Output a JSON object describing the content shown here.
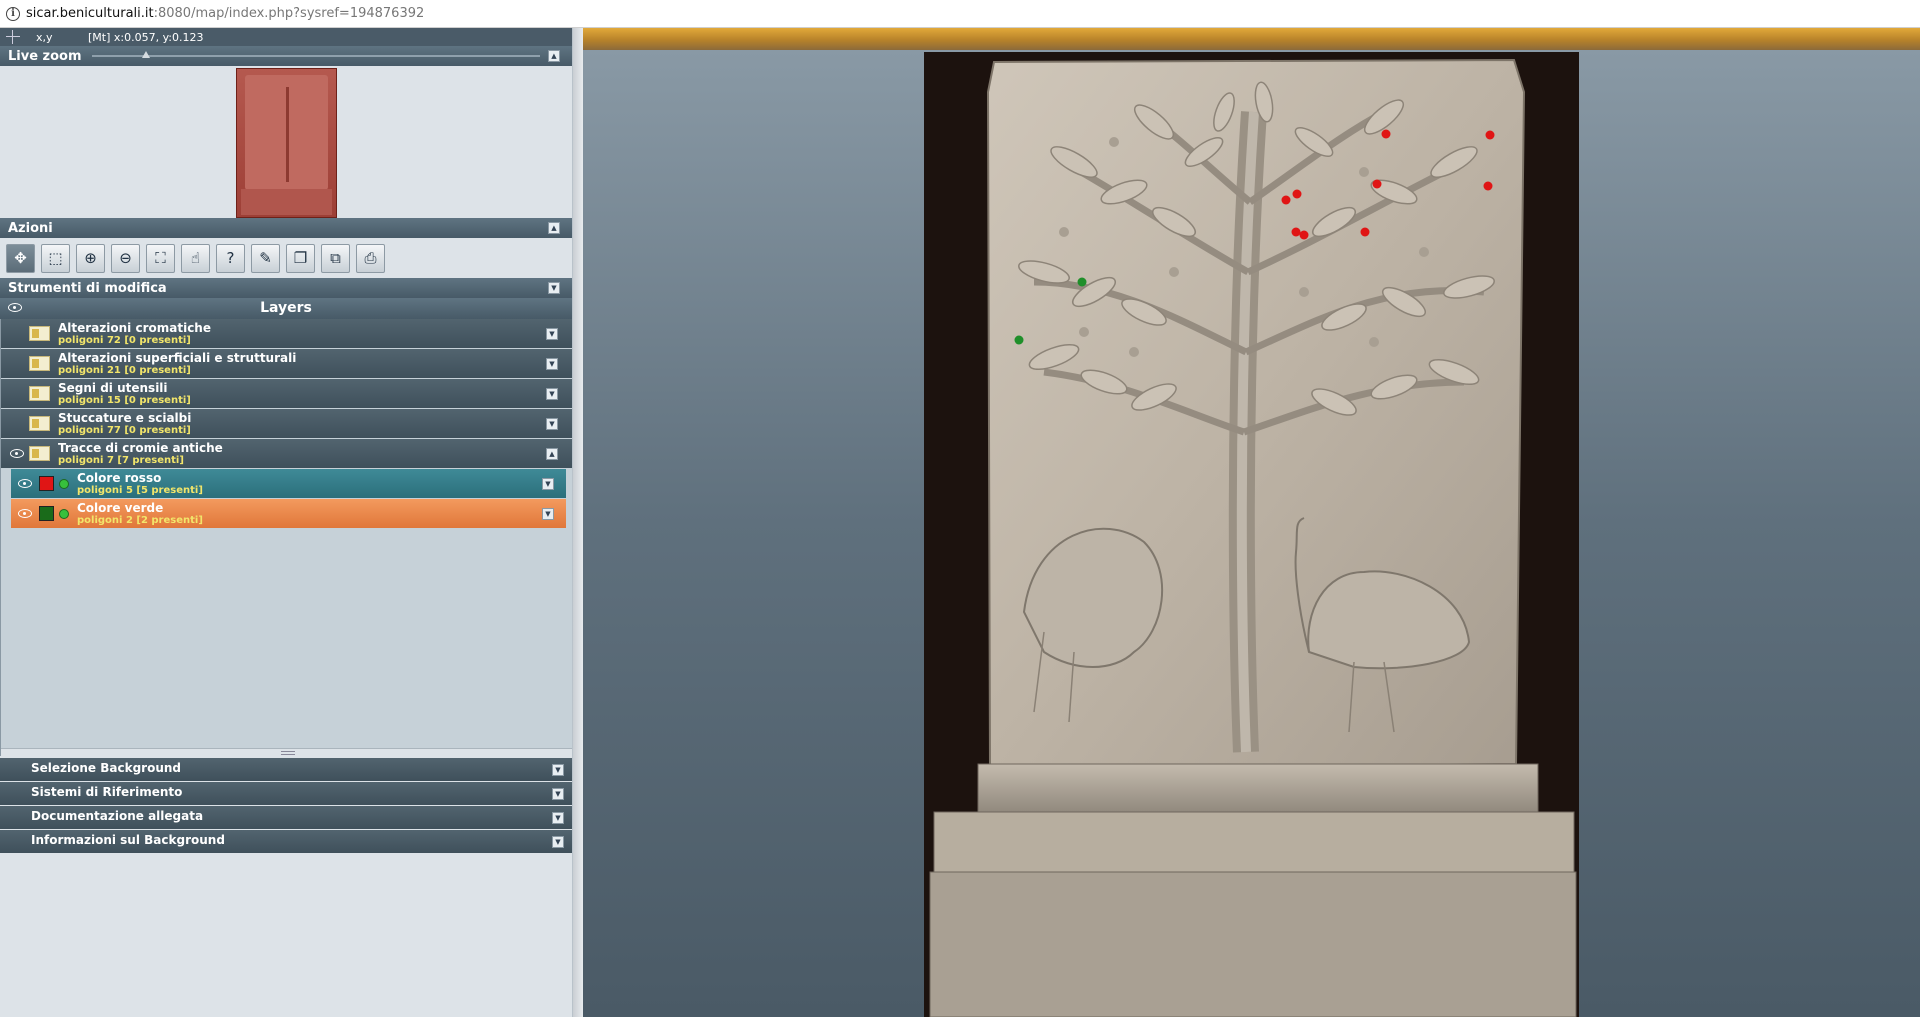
{
  "browser": {
    "url_host": "sicar.beniculturali.it",
    "url_rest": ":8080/map/index.php?sysref=194876392"
  },
  "coords": {
    "label": "x,y",
    "value": "[Mt] x:0.057, y:0.123"
  },
  "livezoom": {
    "title": "Live zoom",
    "zoom_level": 0.12
  },
  "actions": {
    "title": "Azioni",
    "tools": [
      {
        "name": "pan-icon",
        "glyph": "✥"
      },
      {
        "name": "box-select-icon",
        "glyph": "⬚"
      },
      {
        "name": "zoom-in-icon",
        "glyph": "⊕"
      },
      {
        "name": "zoom-out-icon",
        "glyph": "⊖"
      },
      {
        "name": "full-extent-icon",
        "glyph": "⛶"
      },
      {
        "name": "identify-icon",
        "glyph": "☝"
      },
      {
        "name": "help-icon",
        "glyph": "?"
      },
      {
        "name": "draw-pencil-icon",
        "glyph": "✎"
      },
      {
        "name": "layers-copy-icon",
        "glyph": "❐"
      },
      {
        "name": "export-icon",
        "glyph": "⧉"
      },
      {
        "name": "print-icon",
        "glyph": "⎙"
      }
    ]
  },
  "edit_tools": {
    "title": "Strumenti di modifica"
  },
  "layers": {
    "title": "Layers",
    "items": [
      {
        "name": "Alterazioni cromatiche",
        "count": "poligoni 72 [0 presenti]",
        "visible": false
      },
      {
        "name": "Alterazioni superficiali e strutturali",
        "count": "poligoni 21 [0 presenti]",
        "visible": false
      },
      {
        "name": "Segni di utensili",
        "count": "poligoni 15 [0 presenti]",
        "visible": false
      },
      {
        "name": "Stuccature e scialbi",
        "count": "poligoni 77 [0 presenti]",
        "visible": false
      },
      {
        "name": "Tracce di cromie antiche",
        "count": "poligoni 7 [7 presenti]",
        "visible": true
      }
    ],
    "sublayers": [
      {
        "name": "Colore rosso",
        "count": "poligoni 5 [5 presenti]",
        "swatch": "#e01515",
        "style": "teal"
      },
      {
        "name": "Colore verde",
        "count": "poligoni 2 [2 presenti]",
        "swatch": "#1a6b1a",
        "style": "orange"
      }
    ]
  },
  "accordion": [
    {
      "label": "Selezione Background"
    },
    {
      "label": "Sistemi di Riferimento"
    },
    {
      "label": "Documentazione allegata"
    },
    {
      "label": "Informazioni sul Background"
    }
  ],
  "colors": {
    "panel_header": "#4f6270",
    "accent_orange": "#f39a5e",
    "accent_teal": "#3f8a97",
    "map_bar": "#e2a93a",
    "red_marker": "#e01515",
    "green_marker": "#1f8f2a"
  }
}
